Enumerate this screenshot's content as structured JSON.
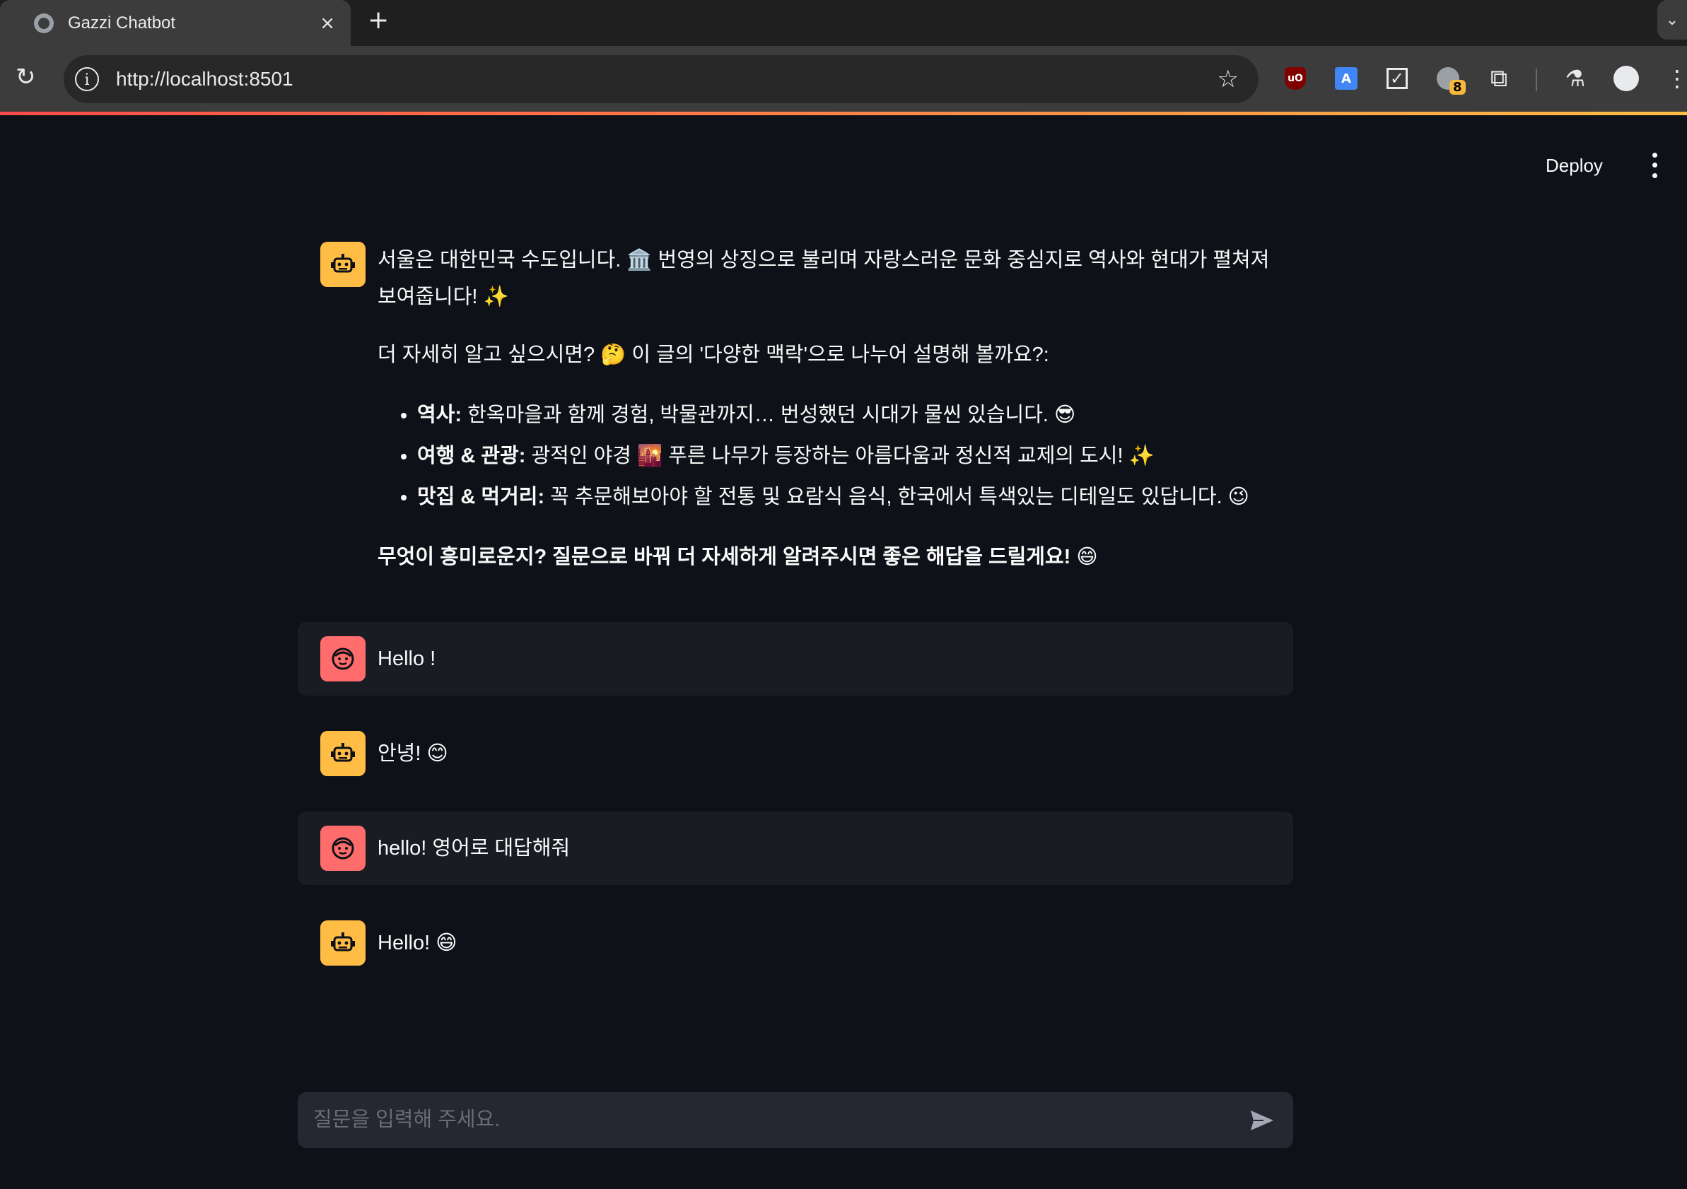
{
  "browser": {
    "tab_title": "Gazzi Chatbot",
    "tab_close": "×",
    "new_tab": "+",
    "url": "http://localhost:8501",
    "extension_badge": "8",
    "tab_menu": "⌄"
  },
  "app": {
    "deploy_label": "Deploy"
  },
  "messages": [
    {
      "role": "assistant",
      "paragraphs": [
        "서울은 대한민국 수도입니다. 🏛️ 번영의 상징으로 불리며 자랑스러운 문화 중심지로 역사와 현대가 펼쳐져 보여줍니다! ✨",
        "더 자세히 알고 싶으시면? 🤔 이 글의 '다양한 맥락'으로 나누어 설명해 볼까요?:"
      ],
      "bullets": [
        {
          "label": "역사:",
          "text": " 한옥마을과 함께 경험, 박물관까지… 번성했던 시대가 물씬 있습니다. 😎"
        },
        {
          "label": "여행 & 관광:",
          "text": " 광적인 야경 🌇 푸른 나무가 등장하는 아름다움과 정신적 교제의 도시! ✨"
        },
        {
          "label": "맛집 & 먹거리:",
          "text": " 꼭 추문해보아야 할 전통 및 요람식 음식, 한국에서 특색있는 디테일도 있답니다. 😉"
        }
      ],
      "closing": "무엇이 흥미로운지? 질문으로 바꿔 더 자세하게 알려주시면 좋은 해답을 드릴게요! 😄"
    },
    {
      "role": "user",
      "text": "Hello !"
    },
    {
      "role": "assistant",
      "text": "안녕! 😊"
    },
    {
      "role": "user",
      "text": "hello! 영어로 대답해줘"
    },
    {
      "role": "assistant",
      "text": "Hello! 😄"
    }
  ],
  "input": {
    "placeholder": "질문을 입력해 주세요.",
    "value": ""
  },
  "colors": {
    "app_bg": "#0e1117",
    "user_msg_bg": "#1a1c24",
    "bot_avatar": "#ffbd45",
    "user_avatar": "#ff6c6c",
    "input_bg": "#262730"
  },
  "icons": {
    "bot_avatar": "robot-icon",
    "user_avatar": "face-icon",
    "send": "send-icon"
  }
}
